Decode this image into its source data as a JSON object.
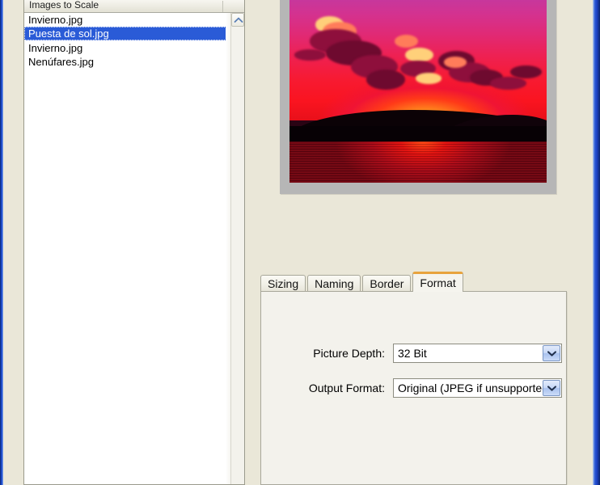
{
  "window": {
    "chrome_color": "#1B46C8",
    "background_color": "#EAE7D8"
  },
  "file_list": {
    "header_label": "Images to Scale",
    "items": [
      {
        "name": "Invierno.jpg",
        "selected": false
      },
      {
        "name": "Puesta de sol.jpg",
        "selected": true
      },
      {
        "name": "Invierno.jpg",
        "selected": false
      },
      {
        "name": "Nenúfares.jpg",
        "selected": false
      }
    ],
    "scrollbar": {
      "up_arrow_icon": "chevron-up-icon"
    }
  },
  "preview": {
    "alt": "Puesta de sol.jpg",
    "description": "Sunset over water with pink and red sky",
    "frame_color": "#B6B6B6"
  },
  "tabs": {
    "items": [
      {
        "label": "Sizing",
        "active": false
      },
      {
        "label": "Naming",
        "active": false
      },
      {
        "label": "Border",
        "active": false
      },
      {
        "label": "Format",
        "active": true
      }
    ],
    "active_accent_color": "#E8A33D"
  },
  "format_tab": {
    "fields": [
      {
        "label": "Picture Depth:",
        "value": "32 Bit",
        "dropdown_icon": "chevron-down-icon"
      },
      {
        "label": "Output Format:",
        "value": "Original (JPEG if unsupported)",
        "dropdown_icon": "chevron-down-icon"
      }
    ]
  }
}
